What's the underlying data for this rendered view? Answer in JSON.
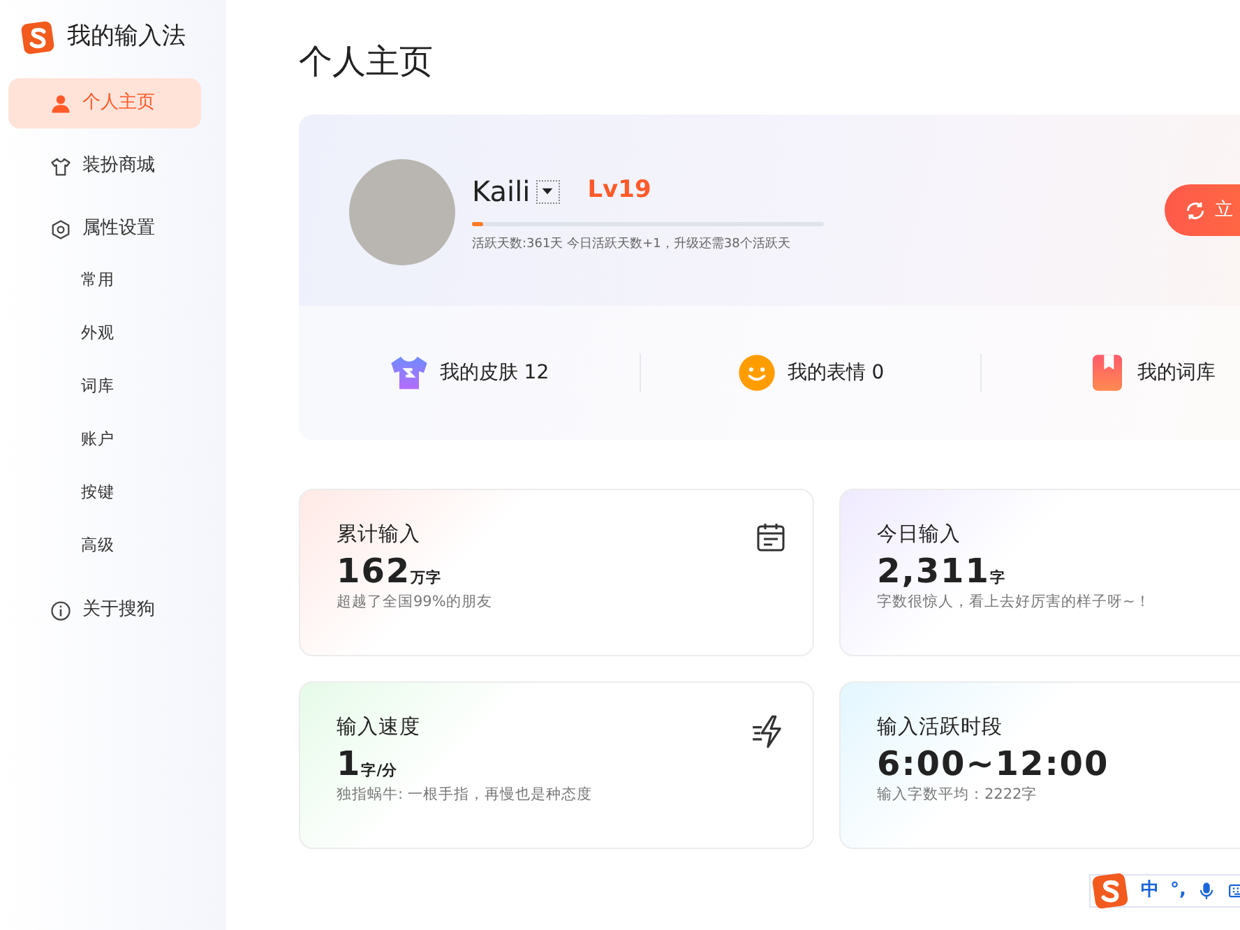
{
  "app": {
    "title": "我的输入法"
  },
  "nav": [
    {
      "label": "个人主页",
      "kind": "person",
      "selected": true
    },
    {
      "label": "装扮商城",
      "kind": "shirt",
      "selected": false
    },
    {
      "label": "属性设置",
      "kind": "settings",
      "selected": false,
      "children": [
        {
          "label": "常用",
          "selected": false
        },
        {
          "label": "外观",
          "selected": false
        },
        {
          "label": "词库",
          "selected": false
        },
        {
          "label": "账户",
          "selected": false
        },
        {
          "label": "按键",
          "selected": false
        },
        {
          "label": "高级",
          "selected": false
        }
      ]
    },
    {
      "label": "关于搜狗",
      "kind": "info",
      "selected": false
    }
  ],
  "page_title": "个人主页",
  "profile": {
    "name": "Kaili",
    "level_label": "Lv19",
    "progress": {
      "level": 0.03
    },
    "progress_text": "活跃天数:361天 今日活跃天数+1，升级还需38个活跃天",
    "button": "立"
  },
  "assets": [
    {
      "label": "我的皮肤 12",
      "kind": "skin"
    },
    {
      "label": "我的表情 0",
      "kind": "emoji"
    },
    {
      "label": "我的词库",
      "kind": "bookmark"
    }
  ],
  "stats": [
    {
      "title": "累计输入",
      "value": "162",
      "unit": "万字",
      "note": "超越了全国99%的朋友",
      "kind": "calendar"
    },
    {
      "title": "今日输入",
      "value": "2,311",
      "unit": "字",
      "note": "字数很惊人，看上去好厉害的样子呀~！",
      "kind": "plain"
    },
    {
      "title": "输入速度",
      "value": "1",
      "unit": "字/分",
      "note": "独指蜗牛: 一根手指，再慢也是种态度",
      "kind": "bolt"
    },
    {
      "title": "输入活跃时段",
      "value": "6:00~12:00",
      "note": "输入字数平均：2222字",
      "kind": "plain"
    }
  ],
  "ime_toolbar": {
    "items": [
      "中",
      "°,"
    ]
  }
}
